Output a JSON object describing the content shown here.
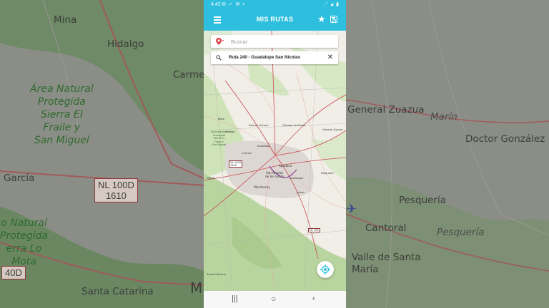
{
  "status_bar": {
    "time": "4:42",
    "left_icons": "✉ ✓ ✉ •",
    "right_icons": "⋰ ▲ ▮"
  },
  "app_bar": {
    "title": "MIS RUTAS"
  },
  "search": {
    "placeholder": "Buscar"
  },
  "route": {
    "label": "Ruta 240 - Guadalupe San Nicolas"
  },
  "map": {
    "labels": {
      "area": "Área Natural\nProtegida\nSierra El\nFraile y\nSan Miguel",
      "mina": "Mina",
      "hidalgo": "Hidalgo",
      "carmen": "Carmen",
      "garcia": "García",
      "shield": "NL 100D\n1610",
      "san_nicolas": "San Nicolás\nde los Garza",
      "apodaca": "Apodaca",
      "monterrey": "Monterrey",
      "escobedo": "Escobedo",
      "general_zuazua": "General Zuazua",
      "pesqueria": "Pesquería",
      "santa_catarina": "Santa Catarina",
      "guadalupe": "Guadalupe",
      "juarez": "Juárez",
      "cienega": "Ciénega de Flores",
      "salinas": "Salinas Victoria",
      "route_nl100": "NL 100",
      "nl100d": "NL 100D\n1610"
    }
  },
  "background": {
    "mina": "Mina",
    "hidalgo": "Hidalgo",
    "carmen": "Carme",
    "area": "Área Natural\nProtegida\nSierra El\nFraile y\nSan Miguel",
    "garcia": "García",
    "shield": "NL 100D\n1610",
    "area2": "o Natural\nProtegida\nerra Lo\nMota",
    "shield2": "40D",
    "santa_catarina": "Santa Catarina",
    "m": "M",
    "general_zuazua": "General Zuazua",
    "marin": "Marín",
    "doctor_gonzalez": "Doctor González",
    "pesqueria": "Pesquería",
    "cantoral": "Cantoral",
    "pesqueria_river": "Pesquería",
    "valle": "Valle de Santa\nMaría"
  },
  "colors": {
    "accent": "#2ebfde",
    "pin": "#d9434a",
    "route": "#c9484d"
  },
  "icons": {
    "menu": "menu-icon",
    "star": "star-icon",
    "save": "save-icon",
    "pin": "map-pin-icon",
    "search": "search-icon",
    "close": "close-icon",
    "locate": "my-location-icon"
  }
}
